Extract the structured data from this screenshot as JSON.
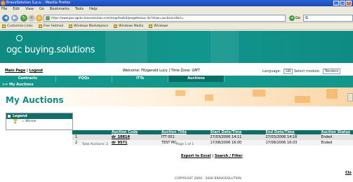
{
  "window": {
    "title": "BravoSolution S.p.a. - Mozilla Firefox",
    "controls": [
      "_",
      "□",
      "×"
    ]
  },
  "menu": [
    "File",
    "Edit",
    "View",
    "Go",
    "Bookmarks",
    "Tools",
    "Help"
  ],
  "nav": {
    "url": "https://www.gov.ogcbs.bravosolution.com/esop/toolkit/progetto/auc.do?show=auctionList&rt=",
    "go_label": "Go",
    "search_label": "G"
  },
  "bookmarks": [
    "Customize Links",
    "Free Hotmail",
    "Windows Marketplace",
    "Windows Media",
    "Windows"
  ],
  "site": {
    "logo_text": "ogc buying.solutions"
  },
  "userbar": {
    "main_page": "Main Page",
    "separator": "|",
    "logout": "Logout",
    "welcome": "Welcome: Fitzgerald Lucy | Time Zone: GMT",
    "language_label": "Language:",
    "language_value": "GB",
    "module_label": "Select module:",
    "module_value": "Tenders"
  },
  "tabs": [
    {
      "label": "Contracts",
      "active": false
    },
    {
      "label": "PQQs",
      "active": false
    },
    {
      "label": "ITTs",
      "active": false
    },
    {
      "label": "Auctions",
      "active": true
    }
  ],
  "breadcrumb": ">> My Auctions",
  "page_title": "My Auctions",
  "legend": {
    "title": "Legend",
    "item": "= Winner"
  },
  "table": {
    "headers": [
      "",
      "Auction Code",
      "Auction Title",
      "Start Date/Time",
      "End Date/Time",
      "Auction Status"
    ],
    "rows": [
      [
        "1",
        "dr_10814",
        "ITT 001",
        "27/03/2006 14:11",
        "27/03/2006 14:18",
        "Ended"
      ],
      [
        "2",
        "dr_9571",
        "TEST MC",
        "17/08/2006 16:00",
        "17/08/2006 16:03",
        "Ended"
      ]
    ]
  },
  "total": "Total Auctions: 2",
  "page_info": "Page 1 of 1",
  "actions": {
    "export": "Export to Excel",
    "sep": "|",
    "search": "Search / Filter"
  },
  "right_link": "Clo",
  "footer": "COPYRIGHT 2000 - 2006 BRAVOSOLUTION"
}
